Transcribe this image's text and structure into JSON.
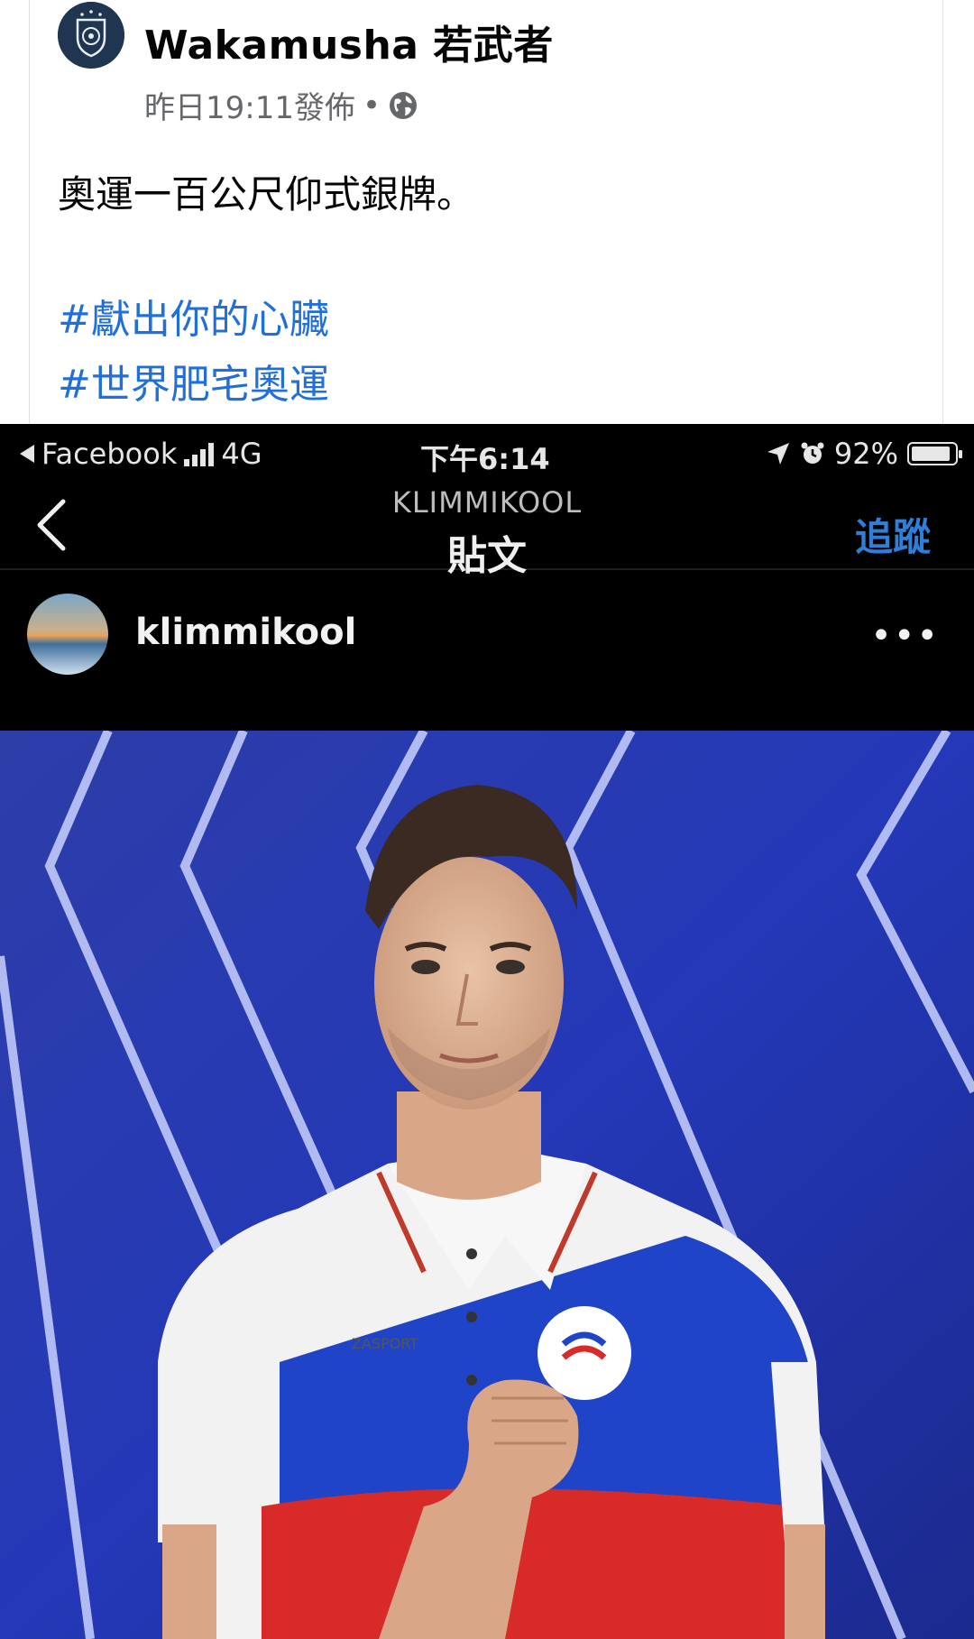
{
  "post": {
    "author": "Wakamusha 若武者",
    "timestamp": "昨日19:11發佈",
    "separator": "•",
    "privacy_icon": "globe-icon",
    "text": "奧運一百公尺仰式銀牌。",
    "hashtags": [
      "#獻出你的心臟",
      "#世界肥宅奧運"
    ],
    "colors": {
      "hashtag": "#216fdb",
      "meta": "#65676b"
    }
  },
  "screenshot": {
    "status_bar": {
      "back_app": "Facebook",
      "network": "4G",
      "time": "下午6:14",
      "battery": "92%",
      "battery_level": 0.92
    },
    "nav": {
      "username": "KLIMMIKOOL",
      "title": "貼文",
      "follow_label": "追蹤",
      "follow_color": "#2f7fd8"
    },
    "post_header": {
      "username": "klimmikool",
      "more": "•••"
    },
    "photo": {
      "shirt_brand": "ZASPORT"
    }
  }
}
